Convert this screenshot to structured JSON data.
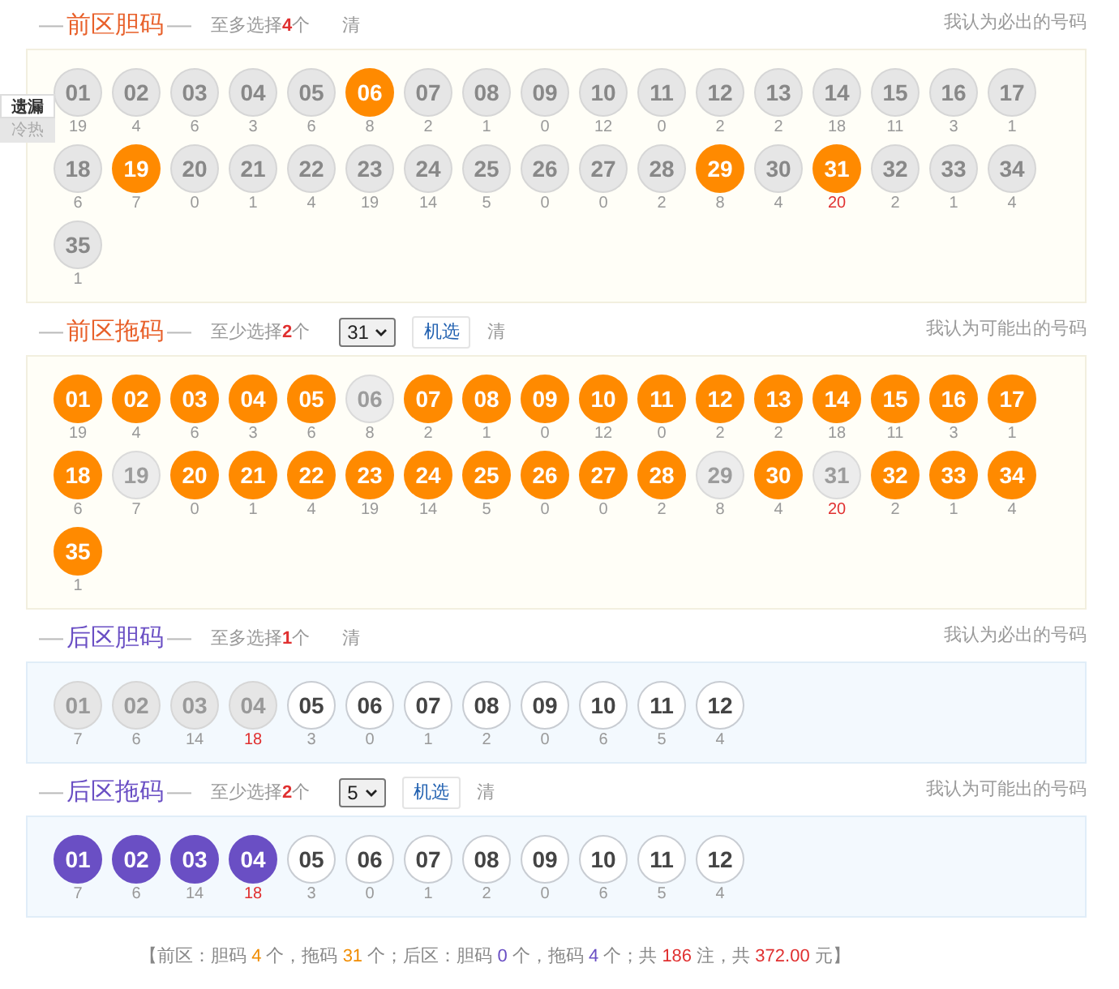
{
  "side_tabs": [
    {
      "label": "遗漏",
      "selected": true
    },
    {
      "label": "冷热",
      "selected": false
    }
  ],
  "sections": [
    {
      "kind": "front",
      "lead": "—",
      "title": "前区胆码",
      "trail": "—",
      "hint": "至多选择**4**个",
      "clear_button": "清",
      "note": "我认为必出的号码",
      "balls": [
        {
          "n": "01",
          "miss": "19",
          "selected": false,
          "disabled": false,
          "hot": false
        },
        {
          "n": "02",
          "miss": "4",
          "selected": false,
          "disabled": false,
          "hot": false
        },
        {
          "n": "03",
          "miss": "6",
          "selected": false,
          "disabled": false,
          "hot": false
        },
        {
          "n": "04",
          "miss": "3",
          "selected": false,
          "disabled": false,
          "hot": false
        },
        {
          "n": "05",
          "miss": "6",
          "selected": false,
          "disabled": false,
          "hot": false
        },
        {
          "n": "06",
          "miss": "8",
          "selected": true,
          "disabled": false,
          "hot": false
        },
        {
          "n": "07",
          "miss": "2",
          "selected": false,
          "disabled": false,
          "hot": false
        },
        {
          "n": "08",
          "miss": "1",
          "selected": false,
          "disabled": false,
          "hot": false
        },
        {
          "n": "09",
          "miss": "0",
          "selected": false,
          "disabled": false,
          "hot": false
        },
        {
          "n": "10",
          "miss": "12",
          "selected": false,
          "disabled": false,
          "hot": false
        },
        {
          "n": "11",
          "miss": "0",
          "selected": false,
          "disabled": false,
          "hot": false
        },
        {
          "n": "12",
          "miss": "2",
          "selected": false,
          "disabled": false,
          "hot": false
        },
        {
          "n": "13",
          "miss": "2",
          "selected": false,
          "disabled": false,
          "hot": false
        },
        {
          "n": "14",
          "miss": "18",
          "selected": false,
          "disabled": false,
          "hot": false
        },
        {
          "n": "15",
          "miss": "11",
          "selected": false,
          "disabled": false,
          "hot": false
        },
        {
          "n": "16",
          "miss": "3",
          "selected": false,
          "disabled": false,
          "hot": false
        },
        {
          "n": "17",
          "miss": "1",
          "selected": false,
          "disabled": false,
          "hot": false
        },
        {
          "n": "18",
          "miss": "6",
          "selected": false,
          "disabled": false,
          "hot": false
        },
        {
          "n": "19",
          "miss": "7",
          "selected": true,
          "disabled": false,
          "hot": false
        },
        {
          "n": "20",
          "miss": "0",
          "selected": false,
          "disabled": false,
          "hot": false
        },
        {
          "n": "21",
          "miss": "1",
          "selected": false,
          "disabled": false,
          "hot": false
        },
        {
          "n": "22",
          "miss": "4",
          "selected": false,
          "disabled": false,
          "hot": false
        },
        {
          "n": "23",
          "miss": "19",
          "selected": false,
          "disabled": false,
          "hot": false
        },
        {
          "n": "24",
          "miss": "14",
          "selected": false,
          "disabled": false,
          "hot": false
        },
        {
          "n": "25",
          "miss": "5",
          "selected": false,
          "disabled": false,
          "hot": false
        },
        {
          "n": "26",
          "miss": "0",
          "selected": false,
          "disabled": false,
          "hot": false
        },
        {
          "n": "27",
          "miss": "0",
          "selected": false,
          "disabled": false,
          "hot": false
        },
        {
          "n": "28",
          "miss": "2",
          "selected": false,
          "disabled": false,
          "hot": false
        },
        {
          "n": "29",
          "miss": "8",
          "selected": true,
          "disabled": false,
          "hot": false
        },
        {
          "n": "30",
          "miss": "4",
          "selected": false,
          "disabled": false,
          "hot": false
        },
        {
          "n": "31",
          "miss": "20",
          "selected": true,
          "disabled": false,
          "hot": true
        },
        {
          "n": "32",
          "miss": "2",
          "selected": false,
          "disabled": false,
          "hot": false
        },
        {
          "n": "33",
          "miss": "1",
          "selected": false,
          "disabled": false,
          "hot": false
        },
        {
          "n": "34",
          "miss": "4",
          "selected": false,
          "disabled": false,
          "hot": false
        },
        {
          "n": "35",
          "miss": "1",
          "selected": false,
          "disabled": false,
          "hot": false
        }
      ]
    },
    {
      "kind": "front",
      "lead": "—",
      "title": "前区拖码",
      "trail": "—",
      "hint": "至少选择**2**个",
      "select_value": "31",
      "random_button": "机选",
      "clear_button": "清",
      "note": "我认为可能出的号码",
      "balls": [
        {
          "n": "01",
          "miss": "19",
          "selected": true,
          "disabled": false,
          "hot": false
        },
        {
          "n": "02",
          "miss": "4",
          "selected": true,
          "disabled": false,
          "hot": false
        },
        {
          "n": "03",
          "miss": "6",
          "selected": true,
          "disabled": false,
          "hot": false
        },
        {
          "n": "04",
          "miss": "3",
          "selected": true,
          "disabled": false,
          "hot": false
        },
        {
          "n": "05",
          "miss": "6",
          "selected": true,
          "disabled": false,
          "hot": false
        },
        {
          "n": "06",
          "miss": "8",
          "selected": false,
          "disabled": true,
          "hot": false
        },
        {
          "n": "07",
          "miss": "2",
          "selected": true,
          "disabled": false,
          "hot": false
        },
        {
          "n": "08",
          "miss": "1",
          "selected": true,
          "disabled": false,
          "hot": false
        },
        {
          "n": "09",
          "miss": "0",
          "selected": true,
          "disabled": false,
          "hot": false
        },
        {
          "n": "10",
          "miss": "12",
          "selected": true,
          "disabled": false,
          "hot": false
        },
        {
          "n": "11",
          "miss": "0",
          "selected": true,
          "disabled": false,
          "hot": false
        },
        {
          "n": "12",
          "miss": "2",
          "selected": true,
          "disabled": false,
          "hot": false
        },
        {
          "n": "13",
          "miss": "2",
          "selected": true,
          "disabled": false,
          "hot": false
        },
        {
          "n": "14",
          "miss": "18",
          "selected": true,
          "disabled": false,
          "hot": false
        },
        {
          "n": "15",
          "miss": "11",
          "selected": true,
          "disabled": false,
          "hot": false
        },
        {
          "n": "16",
          "miss": "3",
          "selected": true,
          "disabled": false,
          "hot": false
        },
        {
          "n": "17",
          "miss": "1",
          "selected": true,
          "disabled": false,
          "hot": false
        },
        {
          "n": "18",
          "miss": "6",
          "selected": true,
          "disabled": false,
          "hot": false
        },
        {
          "n": "19",
          "miss": "7",
          "selected": false,
          "disabled": true,
          "hot": false
        },
        {
          "n": "20",
          "miss": "0",
          "selected": true,
          "disabled": false,
          "hot": false
        },
        {
          "n": "21",
          "miss": "1",
          "selected": true,
          "disabled": false,
          "hot": false
        },
        {
          "n": "22",
          "miss": "4",
          "selected": true,
          "disabled": false,
          "hot": false
        },
        {
          "n": "23",
          "miss": "19",
          "selected": true,
          "disabled": false,
          "hot": false
        },
        {
          "n": "24",
          "miss": "14",
          "selected": true,
          "disabled": false,
          "hot": false
        },
        {
          "n": "25",
          "miss": "5",
          "selected": true,
          "disabled": false,
          "hot": false
        },
        {
          "n": "26",
          "miss": "0",
          "selected": true,
          "disabled": false,
          "hot": false
        },
        {
          "n": "27",
          "miss": "0",
          "selected": true,
          "disabled": false,
          "hot": false
        },
        {
          "n": "28",
          "miss": "2",
          "selected": true,
          "disabled": false,
          "hot": false
        },
        {
          "n": "29",
          "miss": "8",
          "selected": false,
          "disabled": true,
          "hot": false
        },
        {
          "n": "30",
          "miss": "4",
          "selected": true,
          "disabled": false,
          "hot": false
        },
        {
          "n": "31",
          "miss": "20",
          "selected": false,
          "disabled": true,
          "hot": true
        },
        {
          "n": "32",
          "miss": "2",
          "selected": true,
          "disabled": false,
          "hot": false
        },
        {
          "n": "33",
          "miss": "1",
          "selected": true,
          "disabled": false,
          "hot": false
        },
        {
          "n": "34",
          "miss": "4",
          "selected": true,
          "disabled": false,
          "hot": false
        },
        {
          "n": "35",
          "miss": "1",
          "selected": true,
          "disabled": false,
          "hot": false
        }
      ]
    },
    {
      "kind": "back",
      "lead": "—",
      "title": "后区胆码",
      "trail": "—",
      "hint": "至多选择**1**个",
      "clear_button": "清",
      "note": "我认为必出的号码",
      "balls": [
        {
          "n": "01",
          "miss": "7",
          "selected": false,
          "disabled": true,
          "hot": false
        },
        {
          "n": "02",
          "miss": "6",
          "selected": false,
          "disabled": true,
          "hot": false
        },
        {
          "n": "03",
          "miss": "14",
          "selected": false,
          "disabled": true,
          "hot": false
        },
        {
          "n": "04",
          "miss": "18",
          "selected": false,
          "disabled": true,
          "hot": true
        },
        {
          "n": "05",
          "miss": "3",
          "selected": false,
          "disabled": false,
          "hot": false
        },
        {
          "n": "06",
          "miss": "0",
          "selected": false,
          "disabled": false,
          "hot": false
        },
        {
          "n": "07",
          "miss": "1",
          "selected": false,
          "disabled": false,
          "hot": false
        },
        {
          "n": "08",
          "miss": "2",
          "selected": false,
          "disabled": false,
          "hot": false
        },
        {
          "n": "09",
          "miss": "0",
          "selected": false,
          "disabled": false,
          "hot": false
        },
        {
          "n": "10",
          "miss": "6",
          "selected": false,
          "disabled": false,
          "hot": false
        },
        {
          "n": "11",
          "miss": "5",
          "selected": false,
          "disabled": false,
          "hot": false
        },
        {
          "n": "12",
          "miss": "4",
          "selected": false,
          "disabled": false,
          "hot": false
        }
      ]
    },
    {
      "kind": "back",
      "lead": "—",
      "title": "后区拖码",
      "trail": "—",
      "hint": "至少选择**2**个",
      "select_value": "5",
      "random_button": "机选",
      "clear_button": "清",
      "note": "我认为可能出的号码",
      "balls": [
        {
          "n": "01",
          "miss": "7",
          "selected": true,
          "disabled": false,
          "hot": false
        },
        {
          "n": "02",
          "miss": "6",
          "selected": true,
          "disabled": false,
          "hot": false
        },
        {
          "n": "03",
          "miss": "14",
          "selected": true,
          "disabled": false,
          "hot": false
        },
        {
          "n": "04",
          "miss": "18",
          "selected": true,
          "disabled": false,
          "hot": true
        },
        {
          "n": "05",
          "miss": "3",
          "selected": false,
          "disabled": false,
          "hot": false
        },
        {
          "n": "06",
          "miss": "0",
          "selected": false,
          "disabled": false,
          "hot": false
        },
        {
          "n": "07",
          "miss": "1",
          "selected": false,
          "disabled": false,
          "hot": false
        },
        {
          "n": "08",
          "miss": "2",
          "selected": false,
          "disabled": false,
          "hot": false
        },
        {
          "n": "09",
          "miss": "0",
          "selected": false,
          "disabled": false,
          "hot": false
        },
        {
          "n": "10",
          "miss": "6",
          "selected": false,
          "disabled": false,
          "hot": false
        },
        {
          "n": "11",
          "miss": "5",
          "selected": false,
          "disabled": false,
          "hot": false
        },
        {
          "n": "12",
          "miss": "4",
          "selected": false,
          "disabled": false,
          "hot": false
        }
      ]
    }
  ],
  "summary": [
    {
      "text": "【前区：胆码 "
    },
    {
      "text": "4",
      "color": "#f08c00"
    },
    {
      "text": " 个，拖码 "
    },
    {
      "text": "31",
      "color": "#f08c00"
    },
    {
      "text": " 个；后区：胆码 "
    },
    {
      "text": "0",
      "color": "#6a4fc4"
    },
    {
      "text": " 个，拖码 "
    },
    {
      "text": "4",
      "color": "#6a4fc4"
    },
    {
      "text": " 个；共 "
    },
    {
      "text": "186",
      "color": "#e03030"
    },
    {
      "text": " 注，共 "
    },
    {
      "text": "372.00",
      "color": "#e03030"
    },
    {
      "text": " 元】"
    }
  ]
}
